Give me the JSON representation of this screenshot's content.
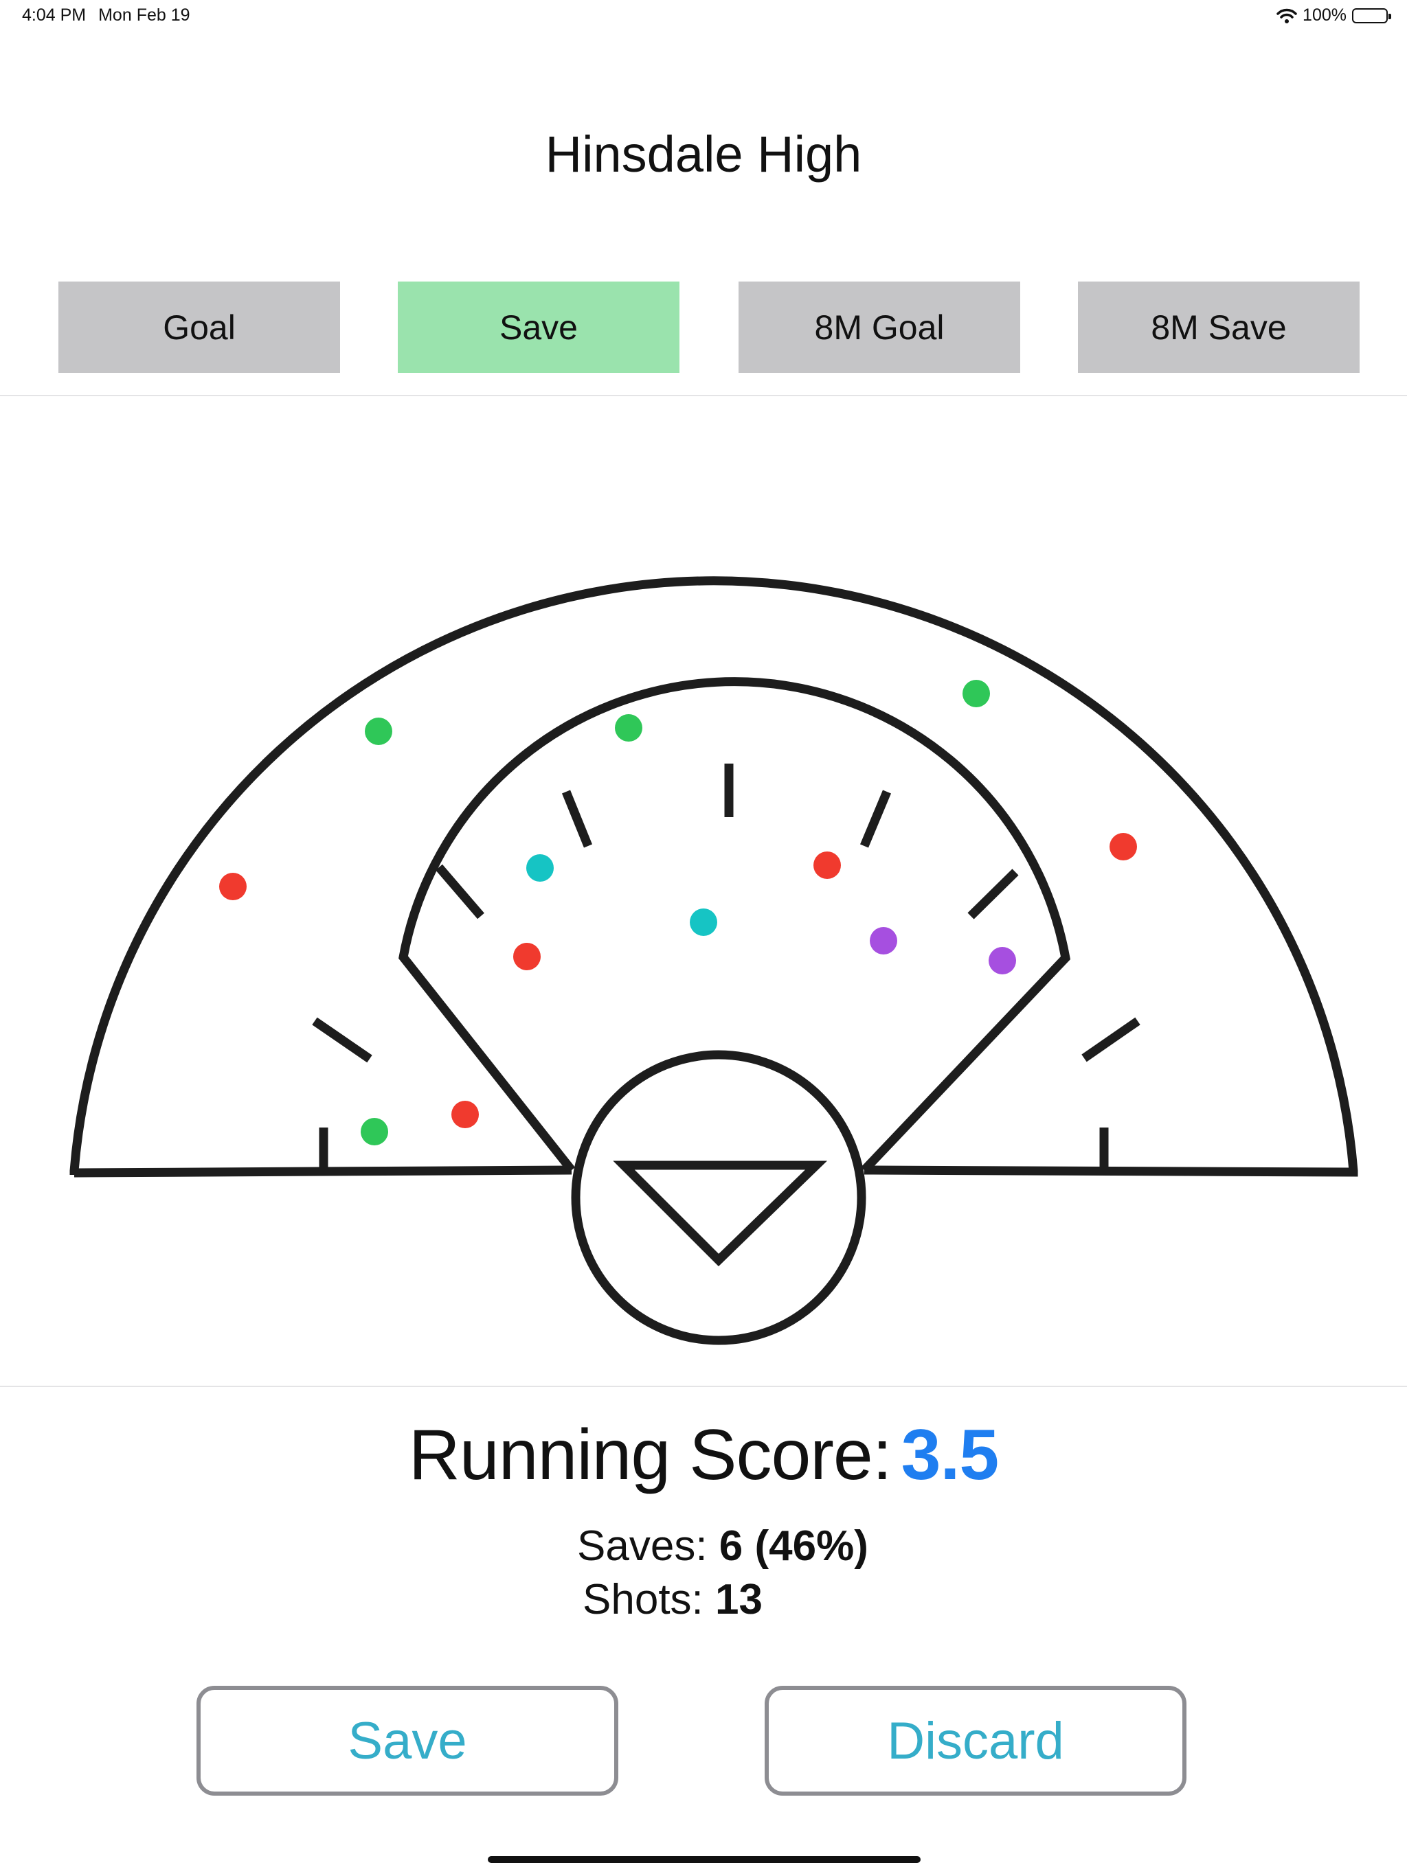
{
  "status_bar": {
    "time": "4:04 PM",
    "date": "Mon Feb 19",
    "battery": "100%",
    "icons": [
      "wifi-icon",
      "battery-icon"
    ]
  },
  "header": {
    "title": "Hinsdale High"
  },
  "shot_types": [
    {
      "label": "Goal",
      "selected": false
    },
    {
      "label": "Save",
      "selected": true
    },
    {
      "label": "8M Goal",
      "selected": false
    },
    {
      "label": "8M Save",
      "selected": false
    }
  ],
  "colors": {
    "selected_button": "#9ae3ad",
    "button": "#c5c5c7",
    "score": "#1f7ef0",
    "action_text": "#35adc9",
    "shot_goal": "#f03a2e",
    "shot_save": "#2fc758",
    "shot_teal": "#16c4c4",
    "shot_purple": "#a64fe0"
  },
  "shots": [
    {
      "id": 1,
      "color": "#2fc758"
    },
    {
      "id": 2,
      "color": "#2fc758"
    },
    {
      "id": 3,
      "color": "#2fc758"
    },
    {
      "id": 4,
      "color": "#f03a2e"
    },
    {
      "id": 5,
      "color": "#f03a2e"
    },
    {
      "id": 6,
      "color": "#16c4c4"
    },
    {
      "id": 7,
      "color": "#f03a2e"
    },
    {
      "id": 8,
      "color": "#16c4c4"
    },
    {
      "id": 9,
      "color": "#f03a2e"
    },
    {
      "id": 10,
      "color": "#a64fe0"
    },
    {
      "id": 11,
      "color": "#a64fe0"
    },
    {
      "id": 12,
      "color": "#2fc758"
    },
    {
      "id": 13,
      "color": "#f03a2e"
    }
  ],
  "summary": {
    "running_label": "Running Score:",
    "running_value": "3.5",
    "saves_label": "Saves:",
    "saves_value": "6",
    "saves_pct": "(46%)",
    "shots_label": "Shots:",
    "shots_value": "13"
  },
  "actions": {
    "save_label": "Save",
    "discard_label": "Discard"
  }
}
